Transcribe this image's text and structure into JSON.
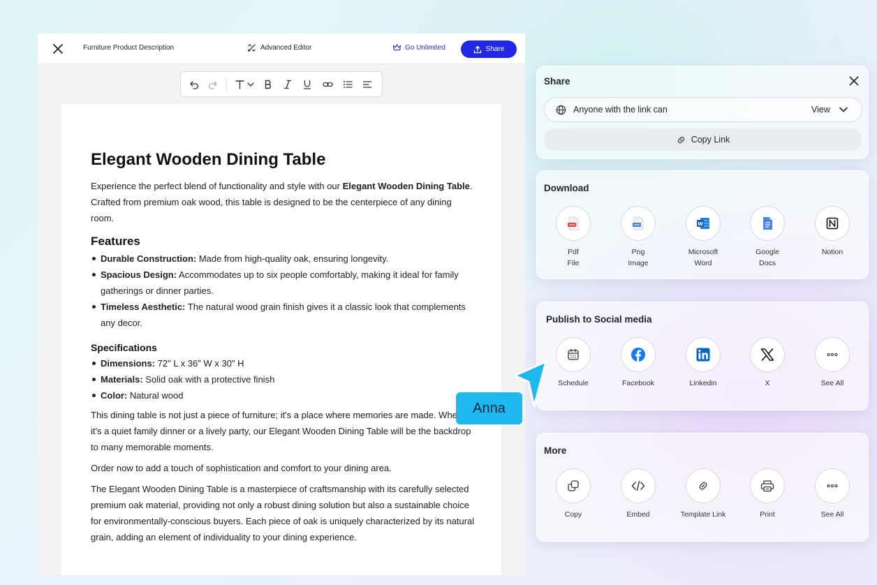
{
  "editor": {
    "doc_title": "Furniture Product Description",
    "advanced_editor": "Advanced Editor",
    "go_unlimited": "Go Unlimited",
    "share_label": "Share"
  },
  "toolbar": {
    "icons": [
      "undo-icon",
      "redo-icon",
      "text-size-icon",
      "bold-icon",
      "italic-icon",
      "underline-icon",
      "link-icon",
      "bullet-list-icon",
      "align-left-icon"
    ]
  },
  "document": {
    "title": "Elegant Wooden Dining Table",
    "intro_prefix": "Experience the perfect blend of functionality and style with our ",
    "intro_bold": "Elegant Wooden Dining Table",
    "intro_suffix": ". Crafted from premium oak wood, this table is designed to be the centerpiece of any dining room.",
    "features_heading": "Features",
    "features": [
      {
        "label": "Durable Construction:",
        "text": " Made from high-quality oak, ensuring longevity."
      },
      {
        "label": "Spacious Design:",
        "text": " Accommodates up to six people comfortably, making it ideal for family gatherings or dinner parties."
      },
      {
        "label": "Timeless Aesthetic:",
        "text": " The natural wood grain finish gives it a classic look that complements any decor."
      }
    ],
    "specs_heading": "Specifications",
    "specs": [
      {
        "label": "Dimensions:",
        "text": " 72\" L x 36\" W x 30\" H"
      },
      {
        "label": "Materials:",
        "text": " Solid oak with a protective finish"
      },
      {
        "label": "Color:",
        "text": " Natural wood"
      }
    ],
    "paragraphs": [
      "This dining table is not just a piece of furniture; it's a place where memories are made. Whether it's a quiet family dinner or a lively party, our Elegant Wooden Dining Table will be the backdrop to many memorable moments.",
      "Order now to add a touch of sophistication and comfort to your dining area.",
      "The Elegant Wooden Dining Table is a masterpiece of craftsmanship with its carefully selected premium oak material, providing not only a robust dining solution but also a sustainable choice for environmentally-conscious buyers. Each piece of oak is uniquely characterized by its natural grain, adding an element of individuality to your dining experience."
    ]
  },
  "share_panel": {
    "title": "Share",
    "link_access": "Anyone with the link can",
    "permission": "View",
    "copy_link": "Copy Link"
  },
  "download": {
    "title": "Download",
    "items": [
      {
        "label": "Pdf\nFile",
        "icon": "pdf-file-icon"
      },
      {
        "label": "Png\nImage",
        "icon": "png-image-icon"
      },
      {
        "label": "Microsoft\nWord",
        "icon": "microsoft-word-icon"
      },
      {
        "label": "Google\nDocs",
        "icon": "google-docs-icon"
      },
      {
        "label": "Notion",
        "icon": "notion-icon"
      }
    ]
  },
  "social": {
    "title": "Publish to Social media",
    "items": [
      {
        "label": "Schedule",
        "icon": "calendar-icon"
      },
      {
        "label": "Facebook",
        "icon": "facebook-icon"
      },
      {
        "label": "Linkedin",
        "icon": "linkedin-icon"
      },
      {
        "label": "X",
        "icon": "x-logo-icon"
      },
      {
        "label": "See All",
        "icon": "more-dots-icon"
      }
    ]
  },
  "more": {
    "title": "More",
    "items": [
      {
        "label": "Copy",
        "icon": "copy-icon"
      },
      {
        "label": "Embed",
        "icon": "code-icon"
      },
      {
        "label": "Template Link",
        "icon": "link-icon"
      },
      {
        "label": "Print",
        "icon": "printer-icon"
      },
      {
        "label": "See All",
        "icon": "more-dots-icon"
      }
    ]
  },
  "collaborator": {
    "name": "Anna",
    "color": "#1fb7f0"
  },
  "colors": {
    "accent": "#2028e6",
    "facebook": "#1877f2",
    "linkedin": "#0a66c2"
  }
}
